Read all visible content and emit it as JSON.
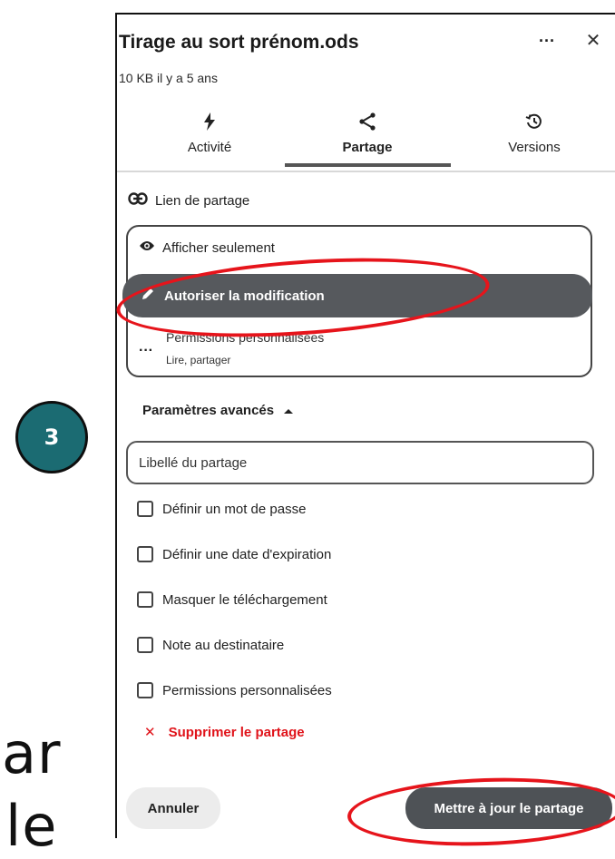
{
  "background": {
    "line1": "ar",
    "line2": "le"
  },
  "step_badge": "3",
  "panel": {
    "title": "Tirage au sort prénom.ods",
    "meta": "10 KB il y a 5 ans",
    "more_icon": "ellipsis-icon",
    "close_icon": "close-icon",
    "tabs": [
      {
        "label": "Activité",
        "icon": "bolt-icon",
        "active": false
      },
      {
        "label": "Partage",
        "icon": "share-icon",
        "active": true
      },
      {
        "label": "Versions",
        "icon": "history-icon",
        "active": false
      }
    ],
    "share_link_label": "Lien de partage",
    "permissions": {
      "view_label": "Afficher seulement",
      "edit_label": "Autoriser la modification",
      "custom_label": "Permissions personnalisées",
      "custom_sub": "Lire, partager",
      "selected": "edit"
    },
    "advanced_label": "Paramètres avancés",
    "label_placeholder": "Libellé du partage",
    "checkboxes": [
      {
        "label": "Définir un mot de passe",
        "checked": false
      },
      {
        "label": "Définir une date d'expiration",
        "checked": false
      },
      {
        "label": "Masquer le téléchargement",
        "checked": false
      },
      {
        "label": "Note au destinataire",
        "checked": false
      },
      {
        "label": "Permissions personnalisées",
        "checked": false
      }
    ],
    "delete_label": "Supprimer le partage",
    "cancel_label": "Annuler",
    "update_label": "Mettre à jour le partage"
  },
  "colors": {
    "accent_dark": "#56595d",
    "danger": "#e0131a",
    "badge": "#1b6b72",
    "annotation": "#e6141b"
  }
}
